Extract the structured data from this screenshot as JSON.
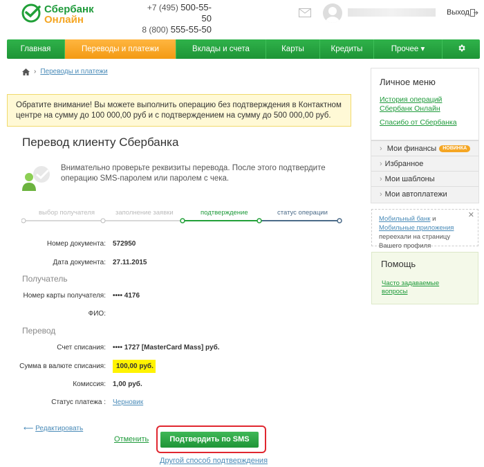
{
  "header": {
    "logo_line1": "Сбербанк",
    "logo_line2": "Онлайн",
    "phone1_prefix": "+7 (495)",
    "phone1_number": "500-55-50",
    "phone2_prefix": "8 (800)",
    "phone2_number": "555-55-50",
    "logout_label": "Выход"
  },
  "nav": {
    "items": [
      {
        "label": "Главная"
      },
      {
        "label": "Переводы и платежи"
      },
      {
        "label": "Вклады и счета"
      },
      {
        "label": "Карты"
      },
      {
        "label": "Кредиты"
      },
      {
        "label": "Прочее ▾"
      }
    ]
  },
  "breadcrumb": {
    "current": "Переводы и платежи"
  },
  "notice": {
    "text": "Обратите внимание! Вы можете выполнить операцию без подтверждения в Контактном центре на сумму до 100 000,00 руб и с подтверждением на сумму до 500 000,00 руб."
  },
  "page": {
    "title": "Перевод клиенту Сбербанка",
    "info": "Внимательно проверьте реквизиты перевода. После этого подтвердите операцию SMS-паролем или паролем с чека."
  },
  "steps": [
    {
      "label": "выбор получателя"
    },
    {
      "label": "заполнение заявки"
    },
    {
      "label": "подтверждение"
    },
    {
      "label": "статус операции"
    }
  ],
  "fields": {
    "doc_number_label": "Номер документа:",
    "doc_number": "572950",
    "doc_date_label": "Дата документа:",
    "doc_date": "27.11.2015",
    "recipient_section": "Получатель",
    "card_label": "Номер карты получателя:",
    "card_value": "•••• 4176",
    "fio_label": "ФИО:",
    "transfer_section": "Перевод",
    "account_label": "Счет списания:",
    "account_value": "•••• 1727  [MasterCard Mass]  руб.",
    "amount_label": "Сумма в валюте списания:",
    "amount_value": "100,00   руб.",
    "fee_label": "Комиссия:",
    "fee_value": "1,00 руб.",
    "status_label": "Статус платежа :",
    "status_value": "Черновик"
  },
  "actions": {
    "edit": "Редактировать",
    "cancel": "Отменить",
    "confirm": "Подтвердить по SMS",
    "alt": "Другой способ подтверждения"
  },
  "sidebar": {
    "title": "Личное меню",
    "link1": "История операций Сбербанк Онлайн",
    "link2": "Спасибо от Сбербанка",
    "rows": [
      {
        "label": "Мои финансы",
        "badge": "НОВИНКА"
      },
      {
        "label": "Избранное"
      },
      {
        "label": "Мои шаблоны"
      },
      {
        "label": "Мои автоплатежи"
      }
    ],
    "tip_link1": "Мобильный банк",
    "tip_and": " и ",
    "tip_link2": "Мобильные приложения",
    "tip_rest": " переехали на страницу Вашего профиля",
    "help_title": "Помощь",
    "help_link": "Часто задаваемые вопросы"
  },
  "colors": {
    "brand_green": "#21a038",
    "active_orange": "#f39a13",
    "highlight_yellow": "#fff300",
    "confirm_frame_red": "#e0262f"
  }
}
